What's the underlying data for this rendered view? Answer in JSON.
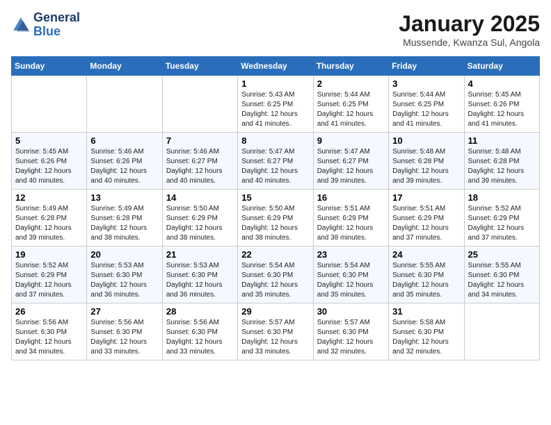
{
  "header": {
    "logo_line1": "General",
    "logo_line2": "Blue",
    "month": "January 2025",
    "location": "Mussende, Kwanza Sul, Angola"
  },
  "weekdays": [
    "Sunday",
    "Monday",
    "Tuesday",
    "Wednesday",
    "Thursday",
    "Friday",
    "Saturday"
  ],
  "weeks": [
    [
      {
        "day": "",
        "sunrise": "",
        "sunset": "",
        "daylight": ""
      },
      {
        "day": "",
        "sunrise": "",
        "sunset": "",
        "daylight": ""
      },
      {
        "day": "",
        "sunrise": "",
        "sunset": "",
        "daylight": ""
      },
      {
        "day": "1",
        "sunrise": "Sunrise: 5:43 AM",
        "sunset": "Sunset: 6:25 PM",
        "daylight": "Daylight: 12 hours and 41 minutes."
      },
      {
        "day": "2",
        "sunrise": "Sunrise: 5:44 AM",
        "sunset": "Sunset: 6:25 PM",
        "daylight": "Daylight: 12 hours and 41 minutes."
      },
      {
        "day": "3",
        "sunrise": "Sunrise: 5:44 AM",
        "sunset": "Sunset: 6:25 PM",
        "daylight": "Daylight: 12 hours and 41 minutes."
      },
      {
        "day": "4",
        "sunrise": "Sunrise: 5:45 AM",
        "sunset": "Sunset: 6:26 PM",
        "daylight": "Daylight: 12 hours and 41 minutes."
      }
    ],
    [
      {
        "day": "5",
        "sunrise": "Sunrise: 5:45 AM",
        "sunset": "Sunset: 6:26 PM",
        "daylight": "Daylight: 12 hours and 40 minutes."
      },
      {
        "day": "6",
        "sunrise": "Sunrise: 5:46 AM",
        "sunset": "Sunset: 6:26 PM",
        "daylight": "Daylight: 12 hours and 40 minutes."
      },
      {
        "day": "7",
        "sunrise": "Sunrise: 5:46 AM",
        "sunset": "Sunset: 6:27 PM",
        "daylight": "Daylight: 12 hours and 40 minutes."
      },
      {
        "day": "8",
        "sunrise": "Sunrise: 5:47 AM",
        "sunset": "Sunset: 6:27 PM",
        "daylight": "Daylight: 12 hours and 40 minutes."
      },
      {
        "day": "9",
        "sunrise": "Sunrise: 5:47 AM",
        "sunset": "Sunset: 6:27 PM",
        "daylight": "Daylight: 12 hours and 39 minutes."
      },
      {
        "day": "10",
        "sunrise": "Sunrise: 5:48 AM",
        "sunset": "Sunset: 6:28 PM",
        "daylight": "Daylight: 12 hours and 39 minutes."
      },
      {
        "day": "11",
        "sunrise": "Sunrise: 5:48 AM",
        "sunset": "Sunset: 6:28 PM",
        "daylight": "Daylight: 12 hours and 39 minutes."
      }
    ],
    [
      {
        "day": "12",
        "sunrise": "Sunrise: 5:49 AM",
        "sunset": "Sunset: 6:28 PM",
        "daylight": "Daylight: 12 hours and 39 minutes."
      },
      {
        "day": "13",
        "sunrise": "Sunrise: 5:49 AM",
        "sunset": "Sunset: 6:28 PM",
        "daylight": "Daylight: 12 hours and 38 minutes."
      },
      {
        "day": "14",
        "sunrise": "Sunrise: 5:50 AM",
        "sunset": "Sunset: 6:29 PM",
        "daylight": "Daylight: 12 hours and 38 minutes."
      },
      {
        "day": "15",
        "sunrise": "Sunrise: 5:50 AM",
        "sunset": "Sunset: 6:29 PM",
        "daylight": "Daylight: 12 hours and 38 minutes."
      },
      {
        "day": "16",
        "sunrise": "Sunrise: 5:51 AM",
        "sunset": "Sunset: 6:29 PM",
        "daylight": "Daylight: 12 hours and 38 minutes."
      },
      {
        "day": "17",
        "sunrise": "Sunrise: 5:51 AM",
        "sunset": "Sunset: 6:29 PM",
        "daylight": "Daylight: 12 hours and 37 minutes."
      },
      {
        "day": "18",
        "sunrise": "Sunrise: 5:52 AM",
        "sunset": "Sunset: 6:29 PM",
        "daylight": "Daylight: 12 hours and 37 minutes."
      }
    ],
    [
      {
        "day": "19",
        "sunrise": "Sunrise: 5:52 AM",
        "sunset": "Sunset: 6:29 PM",
        "daylight": "Daylight: 12 hours and 37 minutes."
      },
      {
        "day": "20",
        "sunrise": "Sunrise: 5:53 AM",
        "sunset": "Sunset: 6:30 PM",
        "daylight": "Daylight: 12 hours and 36 minutes."
      },
      {
        "day": "21",
        "sunrise": "Sunrise: 5:53 AM",
        "sunset": "Sunset: 6:30 PM",
        "daylight": "Daylight: 12 hours and 36 minutes."
      },
      {
        "day": "22",
        "sunrise": "Sunrise: 5:54 AM",
        "sunset": "Sunset: 6:30 PM",
        "daylight": "Daylight: 12 hours and 35 minutes."
      },
      {
        "day": "23",
        "sunrise": "Sunrise: 5:54 AM",
        "sunset": "Sunset: 6:30 PM",
        "daylight": "Daylight: 12 hours and 35 minutes."
      },
      {
        "day": "24",
        "sunrise": "Sunrise: 5:55 AM",
        "sunset": "Sunset: 6:30 PM",
        "daylight": "Daylight: 12 hours and 35 minutes."
      },
      {
        "day": "25",
        "sunrise": "Sunrise: 5:55 AM",
        "sunset": "Sunset: 6:30 PM",
        "daylight": "Daylight: 12 hours and 34 minutes."
      }
    ],
    [
      {
        "day": "26",
        "sunrise": "Sunrise: 5:56 AM",
        "sunset": "Sunset: 6:30 PM",
        "daylight": "Daylight: 12 hours and 34 minutes."
      },
      {
        "day": "27",
        "sunrise": "Sunrise: 5:56 AM",
        "sunset": "Sunset: 6:30 PM",
        "daylight": "Daylight: 12 hours and 33 minutes."
      },
      {
        "day": "28",
        "sunrise": "Sunrise: 5:56 AM",
        "sunset": "Sunset: 6:30 PM",
        "daylight": "Daylight: 12 hours and 33 minutes."
      },
      {
        "day": "29",
        "sunrise": "Sunrise: 5:57 AM",
        "sunset": "Sunset: 6:30 PM",
        "daylight": "Daylight: 12 hours and 33 minutes."
      },
      {
        "day": "30",
        "sunrise": "Sunrise: 5:57 AM",
        "sunset": "Sunset: 6:30 PM",
        "daylight": "Daylight: 12 hours and 32 minutes."
      },
      {
        "day": "31",
        "sunrise": "Sunrise: 5:58 AM",
        "sunset": "Sunset: 6:30 PM",
        "daylight": "Daylight: 12 hours and 32 minutes."
      },
      {
        "day": "",
        "sunrise": "",
        "sunset": "",
        "daylight": ""
      }
    ]
  ]
}
